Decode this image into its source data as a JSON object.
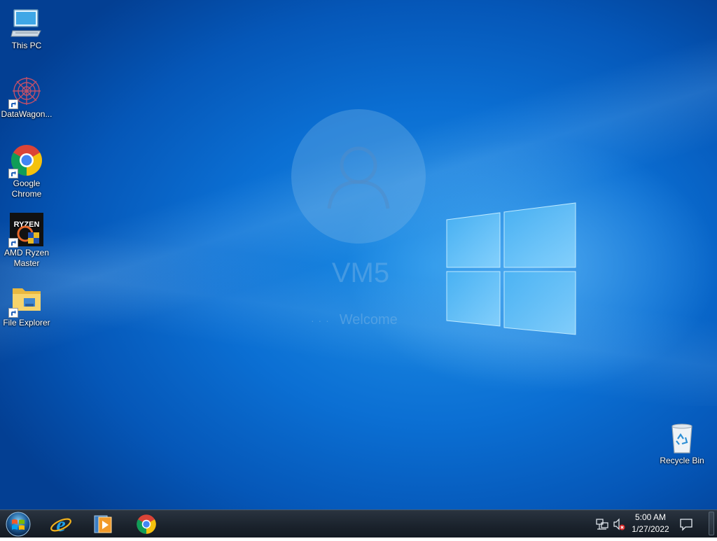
{
  "desktop": {
    "wallpaper": {
      "login_name": "VM5",
      "login_welcome": "Welcome"
    },
    "icons": [
      {
        "label": "This PC",
        "icon": "computer-icon"
      },
      {
        "label": "DataWagon...",
        "icon": "datawagon-icon"
      },
      {
        "label": "Google Chrome",
        "icon": "chrome-icon"
      },
      {
        "label": "AMD Ryzen Master",
        "icon": "ryzen-master-icon"
      },
      {
        "label": "File Explorer",
        "icon": "folder-icon"
      },
      {
        "label": "Recycle Bin",
        "icon": "recycle-bin-icon"
      }
    ]
  },
  "taskbar": {
    "pinned": [
      {
        "name": "Internet Explorer",
        "icon": "internet-explorer-icon"
      },
      {
        "name": "Windows Media Player",
        "icon": "media-player-icon"
      },
      {
        "name": "Google Chrome",
        "icon": "chrome-icon"
      }
    ],
    "tray": {
      "network_icon": "network-icon",
      "volume_icon": "volume-muted-icon",
      "notification_icon": "action-center-icon"
    },
    "clock": {
      "time": "5:00 AM",
      "date": "1/27/2022"
    }
  },
  "colors": {
    "wallpaper_blue": "#0b6fd3",
    "taskbar": "#1a222c",
    "logo_light": "#9fe0ff"
  }
}
